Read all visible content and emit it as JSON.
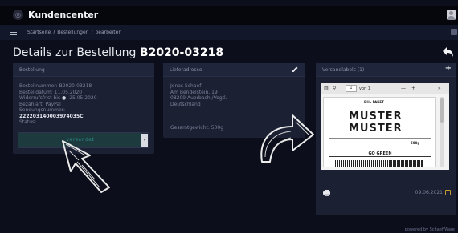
{
  "app": {
    "title": "Kundencenter"
  },
  "breadcrumb": [
    "Startseite",
    "Bestellungen",
    "bearbeiten"
  ],
  "page": {
    "title_prefix": "Details zur Bestellung",
    "order_id": "B2020-03218"
  },
  "order_card": {
    "title": "Bestellung",
    "lines": [
      {
        "label": "Bestellnummer:",
        "value": "B2020-03218"
      },
      {
        "label": "Bestelldatum:",
        "value": "11.05.2020"
      },
      {
        "label": "Widerrufsfrist bis",
        "value": "25.05.2020"
      },
      {
        "label": "Bezahlart:",
        "value": "PayPal"
      },
      {
        "label": "Sendungsnummer:",
        "value": ""
      }
    ],
    "tracking_number": "222203140003974035C",
    "status_label": "Status:",
    "status_value": "versendet"
  },
  "address_card": {
    "title": "Lieferadresse",
    "lines": [
      "Jonas Schaef",
      "Am Bendelstein, 19",
      "08209 Auerbach /Vogtl.",
      "Deutschland"
    ],
    "weight": "Gesamtgewicht: 500g"
  },
  "labels_card": {
    "title": "Versandlabels (1)",
    "viewer": {
      "page": "1",
      "page_total": "von 1",
      "zoom_minus": "—",
      "zoom_plus": "+",
      "header": "DHL PAKET",
      "muster": "MUSTER",
      "go_green": "GO GREEN",
      "weight_tag": "500g"
    },
    "date": "09.06.2021"
  },
  "footer": {
    "credit": "powered by SchaeffWare"
  }
}
